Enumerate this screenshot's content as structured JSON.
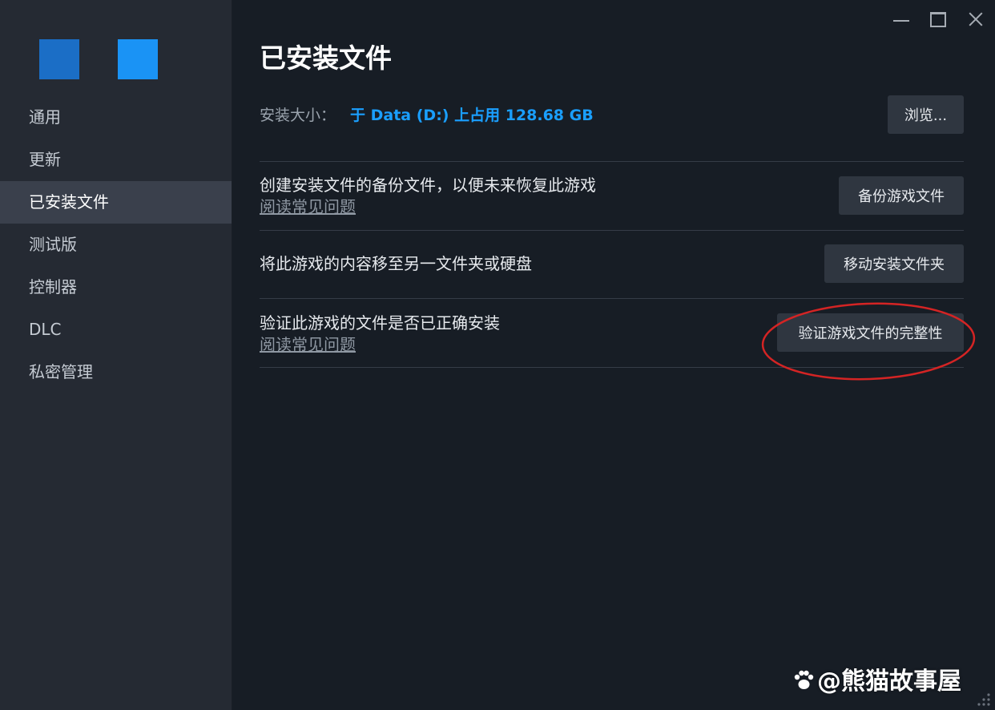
{
  "app": {
    "title": "已安装文件"
  },
  "window_controls": {
    "minimize_icon": "minimize-icon",
    "maximize_icon": "maximize-icon",
    "close_icon": "close-icon"
  },
  "sidebar": {
    "logo_colors": [
      "#1b6ec6",
      "#1a93f5"
    ],
    "items": [
      {
        "label": "通用",
        "active": false
      },
      {
        "label": "更新",
        "active": false
      },
      {
        "label": "已安装文件",
        "active": true
      },
      {
        "label": "测试版",
        "active": false
      },
      {
        "label": "控制器",
        "active": false
      },
      {
        "label": "DLC",
        "active": false
      },
      {
        "label": "私密管理",
        "active": false
      }
    ]
  },
  "main": {
    "install_size_label": "安装大小：",
    "install_size_value": "于 Data (D:) 上占用 128.68 GB",
    "browse_button": "浏览...",
    "rows": [
      {
        "text": "创建安装文件的备份文件，以便未来恢复此游戏",
        "link": "阅读常见问题",
        "button": "备份游戏文件"
      },
      {
        "text": "将此游戏的内容移至另一文件夹或硬盘",
        "button": "移动安装文件夹"
      },
      {
        "text": "验证此游戏的文件是否已正确安装",
        "link": "阅读常见问题",
        "button": "验证游戏文件的完整性"
      }
    ]
  },
  "annotation": {
    "color": "#d42424",
    "target": "verify-integrity-button"
  },
  "watermark": {
    "text": "@熊猫故事屋",
    "icon": "paw-icon"
  },
  "colors": {
    "accent": "#1a9fff",
    "sidebar_bg": "#252a33",
    "active_item_bg": "#3a404c",
    "content_bg": "#171d25",
    "button_bg": "#2f3640"
  }
}
